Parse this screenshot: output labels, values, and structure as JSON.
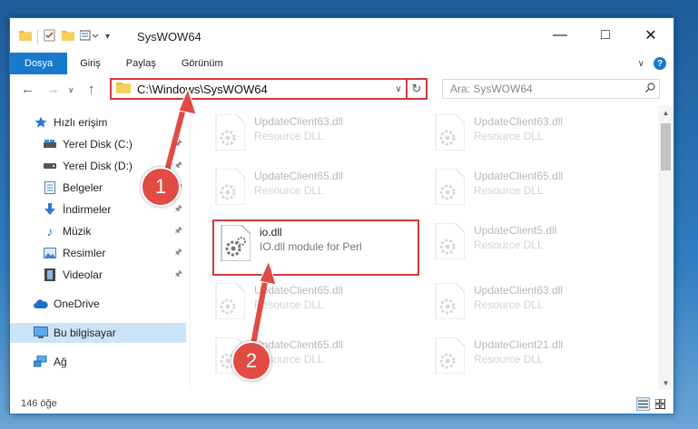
{
  "window": {
    "title": "SysWOW64"
  },
  "ribbon": {
    "tabs": [
      "Dosya",
      "Giriş",
      "Paylaş",
      "Görünüm"
    ]
  },
  "address": {
    "path": "C:\\Windows\\SysWOW64"
  },
  "search": {
    "placeholder": "Ara: SysWOW64"
  },
  "sidebar": {
    "items": [
      {
        "label": "Hızlı erişim"
      },
      {
        "label": "Yerel Disk (C:)"
      },
      {
        "label": "Yerel Disk (D:)"
      },
      {
        "label": "Belgeler"
      },
      {
        "label": "İndirmeler"
      },
      {
        "label": "Müzik"
      },
      {
        "label": "Resimler"
      },
      {
        "label": "Videolar"
      },
      {
        "label": "OneDrive"
      },
      {
        "label": "Bu bilgisayar"
      },
      {
        "label": "Ağ"
      }
    ]
  },
  "files": [
    {
      "name": "UpdateClient63.dll",
      "desc": "Resource DLL"
    },
    {
      "name": "UpdateClient63.dll",
      "desc": "Resource DLL"
    },
    {
      "name": "UpdateClient65.dll",
      "desc": "Resource DLL"
    },
    {
      "name": "UpdateClient65.dll",
      "desc": "Resource DLL"
    },
    {
      "name": "io.dll",
      "desc": "IO.dll module for Perl"
    },
    {
      "name": "UpdateClient5.dll",
      "desc": "Resource DLL"
    },
    {
      "name": "UpdateClient65.dll",
      "desc": "Resource DLL"
    },
    {
      "name": "UpdateClient63.dll",
      "desc": "Resource DLL"
    },
    {
      "name": "UpdateClient65.dll",
      "desc": "Resource DLL"
    },
    {
      "name": "UpdateClient21.dll",
      "desc": "Resource DLL"
    }
  ],
  "status": {
    "count": "146 öğe"
  },
  "annotations": {
    "step1": "1",
    "step2": "2"
  },
  "colors": {
    "accent": "#1979ca",
    "highlight": "#d03a3a",
    "callout": "#e04b43"
  }
}
